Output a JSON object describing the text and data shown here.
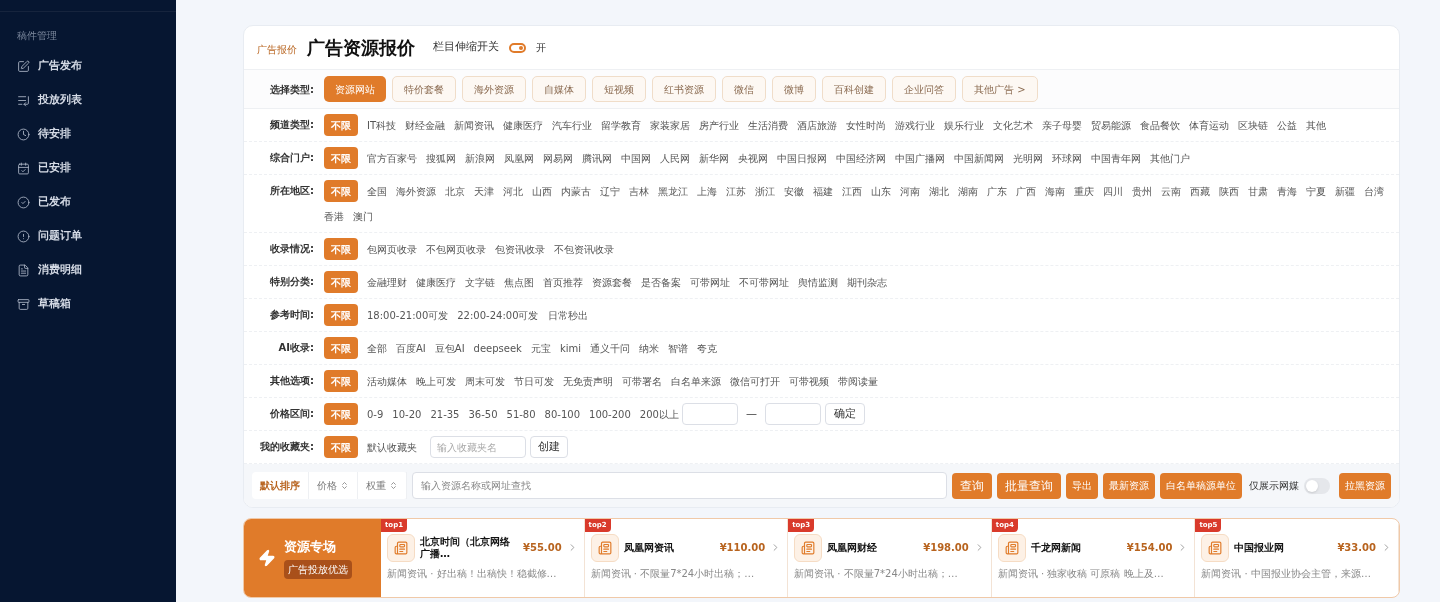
{
  "sidebar": {
    "section": "稿件管理",
    "items": [
      {
        "label": "广告发布"
      },
      {
        "label": "投放列表"
      },
      {
        "label": "待安排"
      },
      {
        "label": "已安排"
      },
      {
        "label": "已发布"
      },
      {
        "label": "问题订单"
      },
      {
        "label": "消费明细"
      },
      {
        "label": "草稿箱"
      }
    ]
  },
  "header": {
    "tag": "广告报价",
    "title": "广告资源报价",
    "switch_label": "栏目伸缩开关",
    "switch_on": true,
    "switch_state": "开"
  },
  "type_row": {
    "label": "选择类型:",
    "options": [
      {
        "label": "资源网站",
        "selected": true
      },
      {
        "label": "特价套餐",
        "selected": false
      },
      {
        "label": "海外资源",
        "selected": false
      },
      {
        "label": "自媒体",
        "selected": false
      },
      {
        "label": "短视频",
        "selected": false
      },
      {
        "label": "红书资源",
        "selected": false
      },
      {
        "label": "微信",
        "selected": false
      },
      {
        "label": "微博",
        "selected": false
      },
      {
        "label": "百科创建",
        "selected": false
      },
      {
        "label": "企业问答",
        "selected": false
      },
      {
        "label": "其他广告 >",
        "selected": false
      }
    ]
  },
  "filters": [
    {
      "kind": "options",
      "label": "频道类型:",
      "options": [
        {
          "label": "不限",
          "selected": true
        },
        {
          "label": "IT科技",
          "selected": false
        },
        {
          "label": "财经金融",
          "selected": false
        },
        {
          "label": "新闻资讯",
          "selected": false
        },
        {
          "label": "健康医疗",
          "selected": false
        },
        {
          "label": "汽车行业",
          "selected": false
        },
        {
          "label": "留学教育",
          "selected": false
        },
        {
          "label": "家装家居",
          "selected": false
        },
        {
          "label": "房产行业",
          "selected": false
        },
        {
          "label": "生活消费",
          "selected": false
        },
        {
          "label": "酒店旅游",
          "selected": false
        },
        {
          "label": "女性时尚",
          "selected": false
        },
        {
          "label": "游戏行业",
          "selected": false
        },
        {
          "label": "娱乐行业",
          "selected": false
        },
        {
          "label": "文化艺术",
          "selected": false
        },
        {
          "label": "亲子母婴",
          "selected": false
        },
        {
          "label": "贸易能源",
          "selected": false
        },
        {
          "label": "食品餐饮",
          "selected": false
        },
        {
          "label": "体育运动",
          "selected": false
        },
        {
          "label": "区块链",
          "selected": false
        },
        {
          "label": "公益",
          "selected": false
        },
        {
          "label": "其他",
          "selected": false
        }
      ]
    },
    {
      "kind": "options",
      "label": "综合门户:",
      "options": [
        {
          "label": "不限",
          "selected": true
        },
        {
          "label": "官方百家号",
          "selected": false
        },
        {
          "label": "搜狐网",
          "selected": false
        },
        {
          "label": "新浪网",
          "selected": false
        },
        {
          "label": "凤凰网",
          "selected": false
        },
        {
          "label": "网易网",
          "selected": false
        },
        {
          "label": "腾讯网",
          "selected": false
        },
        {
          "label": "中国网",
          "selected": false
        },
        {
          "label": "人民网",
          "selected": false
        },
        {
          "label": "新华网",
          "selected": false
        },
        {
          "label": "央视网",
          "selected": false
        },
        {
          "label": "中国日报网",
          "selected": false
        },
        {
          "label": "中国经济网",
          "selected": false
        },
        {
          "label": "中国广播网",
          "selected": false
        },
        {
          "label": "中国新闻网",
          "selected": false
        },
        {
          "label": "光明网",
          "selected": false
        },
        {
          "label": "环球网",
          "selected": false
        },
        {
          "label": "中国青年网",
          "selected": false
        },
        {
          "label": "其他门户",
          "selected": false
        }
      ]
    },
    {
      "kind": "options",
      "label": "所在地区:",
      "options": [
        {
          "label": "不限",
          "selected": true
        },
        {
          "label": "全国",
          "selected": false
        },
        {
          "label": "海外资源",
          "selected": false
        },
        {
          "label": "北京",
          "selected": false
        },
        {
          "label": "天津",
          "selected": false
        },
        {
          "label": "河北",
          "selected": false
        },
        {
          "label": "山西",
          "selected": false
        },
        {
          "label": "内蒙古",
          "selected": false
        },
        {
          "label": "辽宁",
          "selected": false
        },
        {
          "label": "吉林",
          "selected": false
        },
        {
          "label": "黑龙江",
          "selected": false
        },
        {
          "label": "上海",
          "selected": false
        },
        {
          "label": "江苏",
          "selected": false
        },
        {
          "label": "浙江",
          "selected": false
        },
        {
          "label": "安徽",
          "selected": false
        },
        {
          "label": "福建",
          "selected": false
        },
        {
          "label": "江西",
          "selected": false
        },
        {
          "label": "山东",
          "selected": false
        },
        {
          "label": "河南",
          "selected": false
        },
        {
          "label": "湖北",
          "selected": false
        },
        {
          "label": "湖南",
          "selected": false
        },
        {
          "label": "广东",
          "selected": false
        },
        {
          "label": "广西",
          "selected": false
        },
        {
          "label": "海南",
          "selected": false
        },
        {
          "label": "重庆",
          "selected": false
        },
        {
          "label": "四川",
          "selected": false
        },
        {
          "label": "贵州",
          "selected": false
        },
        {
          "label": "云南",
          "selected": false
        },
        {
          "label": "西藏",
          "selected": false
        },
        {
          "label": "陕西",
          "selected": false
        },
        {
          "label": "甘肃",
          "selected": false
        },
        {
          "label": "青海",
          "selected": false
        },
        {
          "label": "宁夏",
          "selected": false
        },
        {
          "label": "新疆",
          "selected": false
        },
        {
          "label": "台湾",
          "selected": false
        },
        {
          "label": "香港",
          "selected": false
        },
        {
          "label": "澳门",
          "selected": false
        }
      ]
    },
    {
      "kind": "options",
      "label": "收录情况:",
      "options": [
        {
          "label": "不限",
          "selected": true
        },
        {
          "label": "包网页收录",
          "selected": false
        },
        {
          "label": "不包网页收录",
          "selected": false
        },
        {
          "label": "包资讯收录",
          "selected": false
        },
        {
          "label": "不包资讯收录",
          "selected": false
        }
      ]
    },
    {
      "kind": "options",
      "label": "特别分类:",
      "options": [
        {
          "label": "不限",
          "selected": true
        },
        {
          "label": "金融理财",
          "selected": false
        },
        {
          "label": "健康医疗",
          "selected": false
        },
        {
          "label": "文字链",
          "selected": false
        },
        {
          "label": "焦点图",
          "selected": false
        },
        {
          "label": "首页推荐",
          "selected": false
        },
        {
          "label": "资源套餐",
          "selected": false
        },
        {
          "label": "是否备案",
          "selected": false
        },
        {
          "label": "可带网址",
          "selected": false
        },
        {
          "label": "不可带网址",
          "selected": false
        },
        {
          "label": "舆情监测",
          "selected": false
        },
        {
          "label": "期刊杂志",
          "selected": false
        }
      ]
    },
    {
      "kind": "options",
      "label": "参考时间:",
      "options": [
        {
          "label": "不限",
          "selected": true
        },
        {
          "label": "18:00-21:00可发",
          "selected": false
        },
        {
          "label": "22:00-24:00可发",
          "selected": false
        },
        {
          "label": "日常秒出",
          "selected": false
        }
      ]
    },
    {
      "kind": "options",
      "label": "AI收录:",
      "options": [
        {
          "label": "不限",
          "selected": true
        },
        {
          "label": "全部",
          "selected": false
        },
        {
          "label": "百度AI",
          "selected": false
        },
        {
          "label": "豆包AI",
          "selected": false
        },
        {
          "label": "deepseek",
          "selected": false
        },
        {
          "label": "元宝",
          "selected": false
        },
        {
          "label": "kimi",
          "selected": false
        },
        {
          "label": "通义千问",
          "selected": false
        },
        {
          "label": "纳米",
          "selected": false
        },
        {
          "label": "智谱",
          "selected": false
        },
        {
          "label": "夸克",
          "selected": false
        }
      ]
    },
    {
      "kind": "options",
      "label": "其他选项:",
      "options": [
        {
          "label": "不限",
          "selected": true
        },
        {
          "label": "活动媒体",
          "selected": false
        },
        {
          "label": "晚上可发",
          "selected": false
        },
        {
          "label": "周末可发",
          "selected": false
        },
        {
          "label": "节日可发",
          "selected": false
        },
        {
          "label": "无免责声明",
          "selected": false
        },
        {
          "label": "可带署名",
          "selected": false
        },
        {
          "label": "白名单来源",
          "selected": false
        },
        {
          "label": "微信可打开",
          "selected": false
        },
        {
          "label": "可带视频",
          "selected": false
        },
        {
          "label": "带阅读量",
          "selected": false
        }
      ]
    },
    {
      "kind": "price",
      "label": "价格区间:",
      "options": [
        {
          "label": "不限",
          "selected": true
        },
        {
          "label": "0-9",
          "selected": false
        },
        {
          "label": "10-20",
          "selected": false
        },
        {
          "label": "21-35",
          "selected": false
        },
        {
          "label": "36-50",
          "selected": false
        },
        {
          "label": "51-80",
          "selected": false
        },
        {
          "label": "80-100",
          "selected": false
        },
        {
          "label": "100-200",
          "selected": false
        },
        {
          "label": "200以上",
          "selected": false
        }
      ],
      "separator": "—",
      "button": "确定"
    },
    {
      "kind": "favorites",
      "label": "我的收藏夹:",
      "options": [
        {
          "label": "不限",
          "selected": true
        },
        {
          "label": "默认收藏夹",
          "selected": false
        }
      ],
      "placeholder": "输入收藏夹名",
      "button": "创建"
    }
  ],
  "toolbar": {
    "sorts": [
      {
        "label": "默认排序",
        "selected": true
      },
      {
        "label": "价格",
        "selected": false
      },
      {
        "label": "权重",
        "selected": false
      }
    ],
    "search_placeholder": "输入资源名称或网址查找",
    "buttons": [
      {
        "label": "查询"
      },
      {
        "label": "批量查询"
      },
      {
        "label": "导出"
      },
      {
        "label": "最新资源"
      },
      {
        "label": "白名单稿源单位"
      }
    ],
    "toggle_label": "仅展示网媒",
    "toggle_on": false,
    "last_button": "拉黑资源"
  },
  "featured": {
    "title": "资源专场",
    "subtitle": "广告投放优选",
    "items": [
      {
        "rank": "top1",
        "name": "北京时间（北京网络广播…",
        "desc": "新闻资讯 · 好出稿！出稿快！稳截修…",
        "price": "¥55.00"
      },
      {
        "rank": "top2",
        "name": "凤凰网资讯",
        "desc": "新闻资讯 · 不限量7*24小时出稿；…",
        "price": "¥110.00"
      },
      {
        "rank": "top3",
        "name": "凤凰网财经",
        "desc": "新闻资讯 · 不限量7*24小时出稿；…",
        "price": "¥198.00"
      },
      {
        "rank": "top4",
        "name": "千龙网新闻",
        "desc": "新闻资讯 · 独家收稿 可原稿 晚上及…",
        "price": "¥154.00"
      },
      {
        "rank": "top5",
        "name": "中国报业网",
        "desc": "新闻资讯 · 中国报业协会主管，来源…",
        "price": "¥33.00"
      }
    ]
  }
}
